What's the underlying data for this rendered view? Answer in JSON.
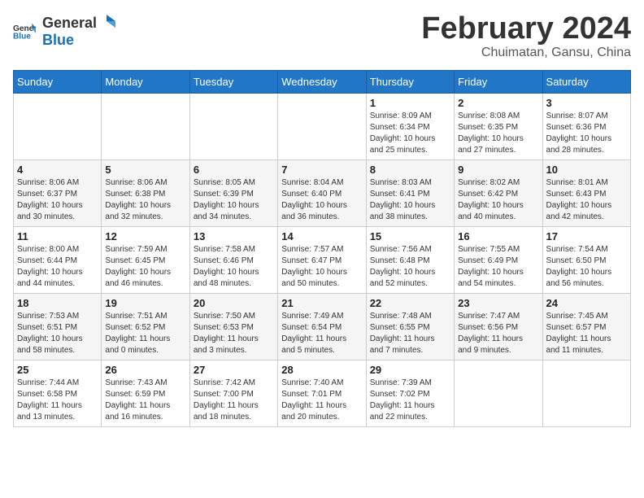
{
  "logo": {
    "general": "General",
    "blue": "Blue"
  },
  "header": {
    "month_year": "February 2024",
    "location": "Chuimatan, Gansu, China"
  },
  "weekdays": [
    "Sunday",
    "Monday",
    "Tuesday",
    "Wednesday",
    "Thursday",
    "Friday",
    "Saturday"
  ],
  "weeks": [
    [
      {
        "day": "",
        "info": ""
      },
      {
        "day": "",
        "info": ""
      },
      {
        "day": "",
        "info": ""
      },
      {
        "day": "",
        "info": ""
      },
      {
        "day": "1",
        "info": "Sunrise: 8:09 AM\nSunset: 6:34 PM\nDaylight: 10 hours\nand 25 minutes."
      },
      {
        "day": "2",
        "info": "Sunrise: 8:08 AM\nSunset: 6:35 PM\nDaylight: 10 hours\nand 27 minutes."
      },
      {
        "day": "3",
        "info": "Sunrise: 8:07 AM\nSunset: 6:36 PM\nDaylight: 10 hours\nand 28 minutes."
      }
    ],
    [
      {
        "day": "4",
        "info": "Sunrise: 8:06 AM\nSunset: 6:37 PM\nDaylight: 10 hours\nand 30 minutes."
      },
      {
        "day": "5",
        "info": "Sunrise: 8:06 AM\nSunset: 6:38 PM\nDaylight: 10 hours\nand 32 minutes."
      },
      {
        "day": "6",
        "info": "Sunrise: 8:05 AM\nSunset: 6:39 PM\nDaylight: 10 hours\nand 34 minutes."
      },
      {
        "day": "7",
        "info": "Sunrise: 8:04 AM\nSunset: 6:40 PM\nDaylight: 10 hours\nand 36 minutes."
      },
      {
        "day": "8",
        "info": "Sunrise: 8:03 AM\nSunset: 6:41 PM\nDaylight: 10 hours\nand 38 minutes."
      },
      {
        "day": "9",
        "info": "Sunrise: 8:02 AM\nSunset: 6:42 PM\nDaylight: 10 hours\nand 40 minutes."
      },
      {
        "day": "10",
        "info": "Sunrise: 8:01 AM\nSunset: 6:43 PM\nDaylight: 10 hours\nand 42 minutes."
      }
    ],
    [
      {
        "day": "11",
        "info": "Sunrise: 8:00 AM\nSunset: 6:44 PM\nDaylight: 10 hours\nand 44 minutes."
      },
      {
        "day": "12",
        "info": "Sunrise: 7:59 AM\nSunset: 6:45 PM\nDaylight: 10 hours\nand 46 minutes."
      },
      {
        "day": "13",
        "info": "Sunrise: 7:58 AM\nSunset: 6:46 PM\nDaylight: 10 hours\nand 48 minutes."
      },
      {
        "day": "14",
        "info": "Sunrise: 7:57 AM\nSunset: 6:47 PM\nDaylight: 10 hours\nand 50 minutes."
      },
      {
        "day": "15",
        "info": "Sunrise: 7:56 AM\nSunset: 6:48 PM\nDaylight: 10 hours\nand 52 minutes."
      },
      {
        "day": "16",
        "info": "Sunrise: 7:55 AM\nSunset: 6:49 PM\nDaylight: 10 hours\nand 54 minutes."
      },
      {
        "day": "17",
        "info": "Sunrise: 7:54 AM\nSunset: 6:50 PM\nDaylight: 10 hours\nand 56 minutes."
      }
    ],
    [
      {
        "day": "18",
        "info": "Sunrise: 7:53 AM\nSunset: 6:51 PM\nDaylight: 10 hours\nand 58 minutes."
      },
      {
        "day": "19",
        "info": "Sunrise: 7:51 AM\nSunset: 6:52 PM\nDaylight: 11 hours\nand 0 minutes."
      },
      {
        "day": "20",
        "info": "Sunrise: 7:50 AM\nSunset: 6:53 PM\nDaylight: 11 hours\nand 3 minutes."
      },
      {
        "day": "21",
        "info": "Sunrise: 7:49 AM\nSunset: 6:54 PM\nDaylight: 11 hours\nand 5 minutes."
      },
      {
        "day": "22",
        "info": "Sunrise: 7:48 AM\nSunset: 6:55 PM\nDaylight: 11 hours\nand 7 minutes."
      },
      {
        "day": "23",
        "info": "Sunrise: 7:47 AM\nSunset: 6:56 PM\nDaylight: 11 hours\nand 9 minutes."
      },
      {
        "day": "24",
        "info": "Sunrise: 7:45 AM\nSunset: 6:57 PM\nDaylight: 11 hours\nand 11 minutes."
      }
    ],
    [
      {
        "day": "25",
        "info": "Sunrise: 7:44 AM\nSunset: 6:58 PM\nDaylight: 11 hours\nand 13 minutes."
      },
      {
        "day": "26",
        "info": "Sunrise: 7:43 AM\nSunset: 6:59 PM\nDaylight: 11 hours\nand 16 minutes."
      },
      {
        "day": "27",
        "info": "Sunrise: 7:42 AM\nSunset: 7:00 PM\nDaylight: 11 hours\nand 18 minutes."
      },
      {
        "day": "28",
        "info": "Sunrise: 7:40 AM\nSunset: 7:01 PM\nDaylight: 11 hours\nand 20 minutes."
      },
      {
        "day": "29",
        "info": "Sunrise: 7:39 AM\nSunset: 7:02 PM\nDaylight: 11 hours\nand 22 minutes."
      },
      {
        "day": "",
        "info": ""
      },
      {
        "day": "",
        "info": ""
      }
    ]
  ]
}
